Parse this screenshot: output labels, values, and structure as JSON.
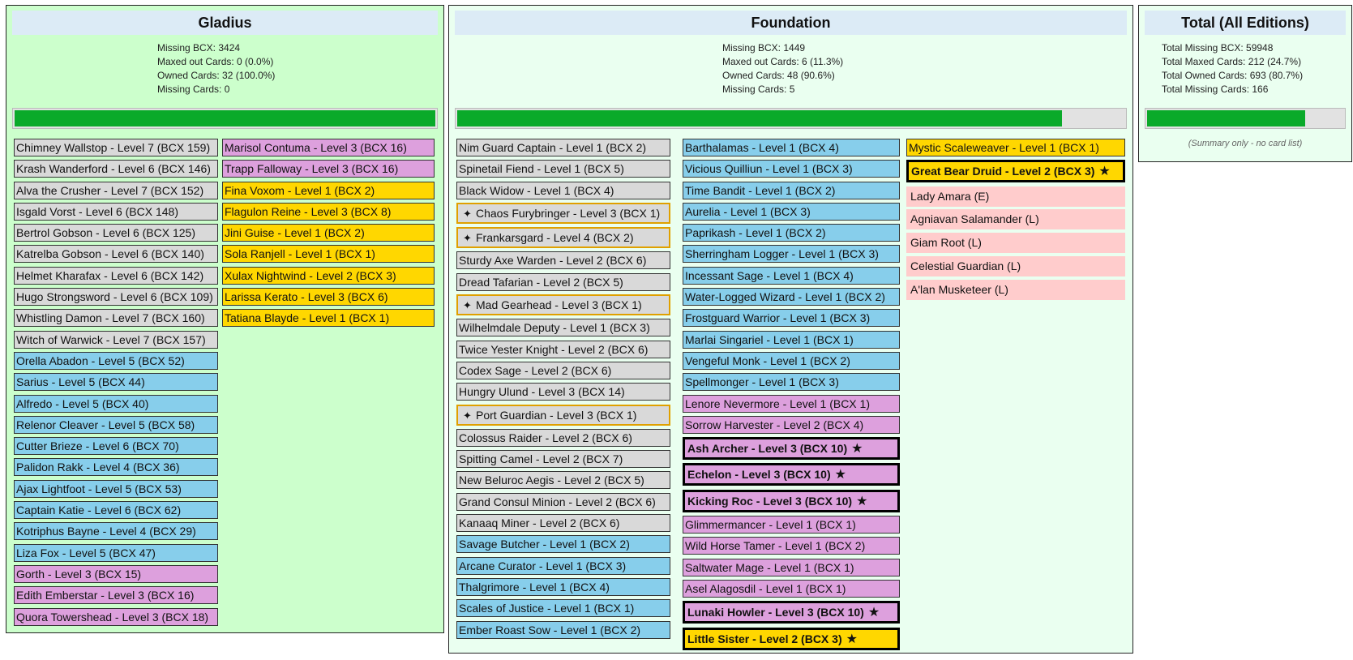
{
  "gladius": {
    "title": "Gladius",
    "stats": [
      "Missing BCX: 3424",
      "Maxed out Cards: 0 (0.0%)",
      "Owned Cards: 32 (100.0%)",
      "Missing Cards: 0"
    ],
    "progress": 1.0,
    "col1": [
      {
        "t": "Chimney Wallstop - Level 7 (BCX 159)",
        "c": "gray"
      },
      {
        "t": "Krash Wanderford - Level 6 (BCX 146)",
        "c": "gray"
      },
      {
        "t": "Alva the Crusher - Level 7 (BCX 152)",
        "c": "gray"
      },
      {
        "t": "Isgald Vorst - Level 6 (BCX 148)",
        "c": "gray"
      },
      {
        "t": "Bertrol Gobson - Level 6 (BCX 125)",
        "c": "gray"
      },
      {
        "t": "Katrelba Gobson - Level 6 (BCX 140)",
        "c": "gray"
      },
      {
        "t": "Helmet Kharafax - Level 6 (BCX 142)",
        "c": "gray"
      },
      {
        "t": "Hugo Strongsword - Level 6 (BCX 109)",
        "c": "gray"
      },
      {
        "t": "Whistling Damon - Level 7 (BCX 160)",
        "c": "gray"
      },
      {
        "t": "Witch of Warwick - Level 7 (BCX 157)",
        "c": "gray"
      },
      {
        "t": "Orella Abadon - Level 5 (BCX 52)",
        "c": "blue"
      },
      {
        "t": "Sarius - Level 5 (BCX 44)",
        "c": "blue"
      },
      {
        "t": "Alfredo - Level 5 (BCX 40)",
        "c": "blue"
      },
      {
        "t": "Relenor Cleaver - Level 5 (BCX 58)",
        "c": "blue"
      },
      {
        "t": "Cutter Brieze - Level 6 (BCX 70)",
        "c": "blue"
      },
      {
        "t": "Palidon Rakk - Level 4 (BCX 36)",
        "c": "blue"
      },
      {
        "t": "Ajax Lightfoot - Level 5 (BCX 53)",
        "c": "blue"
      },
      {
        "t": "Captain Katie - Level 6 (BCX 62)",
        "c": "blue"
      },
      {
        "t": "Kotriphus Bayne - Level 4 (BCX 29)",
        "c": "blue"
      },
      {
        "t": "Liza Fox - Level 5 (BCX 47)",
        "c": "blue"
      },
      {
        "t": "Gorth - Level 3 (BCX 15)",
        "c": "pink"
      },
      {
        "t": "Edith Emberstar - Level 3 (BCX 16)",
        "c": "pink"
      },
      {
        "t": "Quora Towershead - Level 3 (BCX 18)",
        "c": "pink"
      }
    ],
    "col2": [
      {
        "t": "Marisol Contuma - Level 3 (BCX 16)",
        "c": "pink"
      },
      {
        "t": "Trapp Falloway - Level 3 (BCX 16)",
        "c": "pink"
      },
      {
        "t": "Fina Voxom - Level 1 (BCX 2)",
        "c": "gold"
      },
      {
        "t": "Flagulon Reine - Level 3 (BCX 8)",
        "c": "gold"
      },
      {
        "t": "Jini Guise - Level 1 (BCX 2)",
        "c": "gold"
      },
      {
        "t": "Sola Ranjell - Level 1 (BCX 1)",
        "c": "gold"
      },
      {
        "t": "Xulax Nightwind - Level 2 (BCX 3)",
        "c": "gold"
      },
      {
        "t": "Larissa Kerato - Level 3 (BCX 6)",
        "c": "gold"
      },
      {
        "t": "Tatiana Blayde - Level 1 (BCX 1)",
        "c": "gold"
      }
    ]
  },
  "foundation": {
    "title": "Foundation",
    "stats": [
      "Missing BCX: 1449",
      "Maxed out Cards: 6 (11.3%)",
      "Owned Cards: 48 (90.6%)",
      "Missing Cards: 5"
    ],
    "progress": 0.906,
    "col1": [
      {
        "t": "Nim Guard Captain - Level 1 (BCX 2)",
        "c": "gray"
      },
      {
        "t": "Spinetail Fiend - Level 1 (BCX 5)",
        "c": "gray"
      },
      {
        "t": "Black Widow - Level 1 (BCX 4)",
        "c": "gray"
      },
      {
        "t": "Chaos Furybringer - Level 3 (BCX 1)",
        "c": "spark"
      },
      {
        "t": "Frankarsgard - Level 4 (BCX 2)",
        "c": "spark"
      },
      {
        "t": "Sturdy Axe Warden - Level 2 (BCX 6)",
        "c": "gray"
      },
      {
        "t": "Dread Tafarian - Level 2 (BCX 5)",
        "c": "gray"
      },
      {
        "t": "Mad Gearhead - Level 3 (BCX 1)",
        "c": "spark"
      },
      {
        "t": "Wilhelmdale Deputy - Level 1 (BCX 3)",
        "c": "gray"
      },
      {
        "t": "Twice Yester Knight - Level 2 (BCX 6)",
        "c": "gray"
      },
      {
        "t": "Codex Sage - Level 2 (BCX 6)",
        "c": "gray"
      },
      {
        "t": "Hungry Ulund - Level 3 (BCX 14)",
        "c": "gray"
      },
      {
        "t": "Port Guardian - Level 3 (BCX 1)",
        "c": "spark"
      },
      {
        "t": "Colossus Raider - Level 2 (BCX 6)",
        "c": "gray"
      },
      {
        "t": "Spitting Camel - Level 2 (BCX 7)",
        "c": "gray"
      },
      {
        "t": "New Beluroc Aegis - Level 2 (BCX 5)",
        "c": "gray"
      },
      {
        "t": "Grand Consul Minion - Level 2 (BCX 6)",
        "c": "gray"
      },
      {
        "t": "Kanaaq Miner - Level 2 (BCX 6)",
        "c": "gray"
      },
      {
        "t": "Savage Butcher - Level 1 (BCX 2)",
        "c": "blue"
      },
      {
        "t": "Arcane Curator - Level 1 (BCX 3)",
        "c": "blue"
      },
      {
        "t": "Thalgrimore - Level 1 (BCX 4)",
        "c": "blue"
      },
      {
        "t": "Scales of Justice - Level 1 (BCX 1)",
        "c": "blue"
      },
      {
        "t": "Ember Roast Sow - Level 1 (BCX 2)",
        "c": "blue"
      }
    ],
    "col2": [
      {
        "t": "Barthalamas - Level 1 (BCX 4)",
        "c": "blue"
      },
      {
        "t": "Vicious Quilliun - Level 1 (BCX 3)",
        "c": "blue"
      },
      {
        "t": "Time Bandit - Level 1 (BCX 2)",
        "c": "blue"
      },
      {
        "t": "Aurelia - Level 1 (BCX 3)",
        "c": "blue"
      },
      {
        "t": "Paprikash - Level 1 (BCX 2)",
        "c": "blue"
      },
      {
        "t": "Sherringham Logger - Level 1 (BCX 3)",
        "c": "blue"
      },
      {
        "t": "Incessant Sage - Level 1 (BCX 4)",
        "c": "blue"
      },
      {
        "t": "Water-Logged Wizard - Level 1 (BCX 2)",
        "c": "blue"
      },
      {
        "t": "Frostguard Warrior - Level 1 (BCX 3)",
        "c": "blue"
      },
      {
        "t": "Marlai Singariel - Level 1 (BCX 1)",
        "c": "blue"
      },
      {
        "t": "Vengeful Monk - Level 1 (BCX 2)",
        "c": "blue"
      },
      {
        "t": "Spellmonger - Level 1 (BCX 3)",
        "c": "blue"
      },
      {
        "t": "Lenore Nevermore - Level 1 (BCX 1)",
        "c": "pink"
      },
      {
        "t": "Sorrow Harvester - Level 2 (BCX 4)",
        "c": "pink"
      },
      {
        "t": "Ash Archer - Level 3 (BCX 10)",
        "c": "pink",
        "m": true
      },
      {
        "t": "Echelon - Level 3 (BCX 10)",
        "c": "pink",
        "m": true
      },
      {
        "t": "Kicking Roc - Level 3 (BCX 10)",
        "c": "pink",
        "m": true
      },
      {
        "t": "Glimmermancer - Level 1 (BCX 1)",
        "c": "pink"
      },
      {
        "t": "Wild Horse Tamer - Level 1 (BCX 2)",
        "c": "pink"
      },
      {
        "t": "Saltwater Mage - Level 1 (BCX 1)",
        "c": "pink"
      },
      {
        "t": "Asel Alagosdil - Level 1 (BCX 1)",
        "c": "pink"
      },
      {
        "t": "Lunaki Howler - Level 3 (BCX 10)",
        "c": "pink",
        "m": true
      },
      {
        "t": "Little Sister - Level 2 (BCX 3)",
        "c": "gold",
        "m": true
      }
    ],
    "col3": [
      {
        "t": "Mystic Scaleweaver - Level 1 (BCX 1)",
        "c": "gold"
      },
      {
        "t": "Great Bear Druid - Level 2 (BCX 3)",
        "c": "gold",
        "m": true
      },
      {
        "t": "Lady Amara (E)",
        "c": "missing"
      },
      {
        "t": "Agniavan Salamander (L)",
        "c": "missing"
      },
      {
        "t": "Giam Root (L)",
        "c": "missing"
      },
      {
        "t": "Celestial Guardian (L)",
        "c": "missing"
      },
      {
        "t": "A'lan Musketeer (L)",
        "c": "missing"
      }
    ]
  },
  "total": {
    "title": "Total (All Editions)",
    "stats": [
      "Total Missing BCX: 59948",
      "Total Maxed Cards: 212 (24.7%)",
      "Total Owned Cards: 693 (80.7%)",
      "Total Missing Cards: 166"
    ],
    "progress": 0.807,
    "note": "(Summary only - no card list)"
  },
  "icons": {
    "sparkle": "sparkle-icon",
    "star": "star-icon"
  },
  "colors": {
    "gray": "#d9d9d9",
    "blue": "#87ceeb",
    "pink": "#dda0dd",
    "gold": "#ffd700",
    "missing": "#ffcccc",
    "progress": "#0aaa2a"
  }
}
